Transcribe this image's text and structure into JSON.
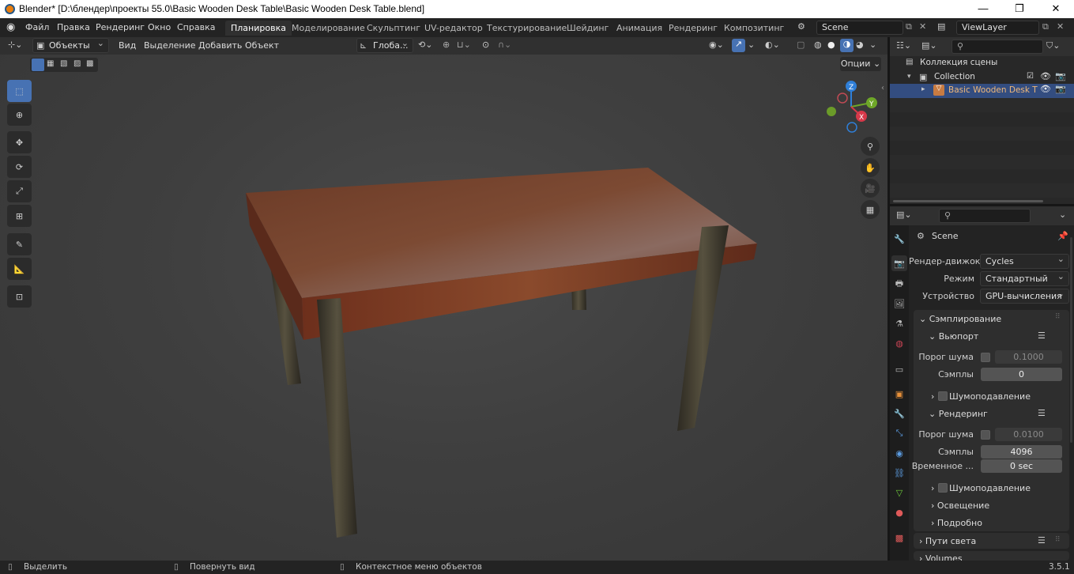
{
  "window": {
    "title": "Blender* [D:\\блендер\\проекты 55.0\\Basic Wooden Desk Table\\Basic Wooden Desk Table.blend]",
    "min_icon": "minimize-icon",
    "max_icon": "maximize-icon",
    "close_icon": "close-icon"
  },
  "menus": [
    "Файл",
    "Правка",
    "Рендеринг",
    "Окно",
    "Справка"
  ],
  "workspaces": [
    "Планировка",
    "Моделирование",
    "Скульптинг",
    "UV-редактор",
    "Текстурирование",
    "Шейдинг",
    "Анимация",
    "Рендеринг",
    "Композитинг"
  ],
  "active_workspace": "Планировка",
  "scene": {
    "value": "Scene"
  },
  "view_layer": {
    "value": "ViewLayer"
  },
  "viewport_header": {
    "mode": "Объекты",
    "menus": [
      "Вид",
      "Выделение",
      "Добавить",
      "Объект"
    ],
    "transform_orientation": "Глоба...",
    "options_label": "Опции"
  },
  "gizmo": {
    "x": "X",
    "y": "Y",
    "z": "Z"
  },
  "tools": [
    "select-box-icon",
    "cursor-icon",
    "move-icon",
    "rotate-icon",
    "scale-icon",
    "transform-icon",
    "annotate-icon",
    "measure-icon",
    "add-cube-icon"
  ],
  "outliner": {
    "title": "Коллекция сцены",
    "collection": "Collection",
    "object": "Basic Wooden Desk T"
  },
  "properties": {
    "context": "Scene",
    "render_engine": {
      "label": "Рендер-движок",
      "value": "Cycles"
    },
    "mode": {
      "label": "Режим",
      "value": "Стандартный"
    },
    "device": {
      "label": "Устройство",
      "value": "GPU-вычисления"
    },
    "sampling": "Сэмплирование",
    "viewport": {
      "title": "Вьюпорт",
      "noise_threshold_label": "Порог шума",
      "noise_threshold_value": "0.1000",
      "samples_label": "Сэмплы",
      "samples_value": "0",
      "denoise_label": "Шумоподавление"
    },
    "render": {
      "title": "Рендеринг",
      "noise_threshold_label": "Порог шума",
      "noise_threshold_value": "0.0100",
      "samples_label": "Сэмплы",
      "samples_value": "4096",
      "time_label": "Временное ...",
      "time_value": "0 sec",
      "denoise_label": "Шумоподавление",
      "lighting_label": "Освещение",
      "advanced_label": "Подробно"
    },
    "light_paths": "Пути света",
    "volumes": "Volumes"
  },
  "status": {
    "select": "Выделить",
    "rotate": "Повернуть вид",
    "context_menu": "Контекстное меню объектов",
    "version": "3.5.1"
  }
}
